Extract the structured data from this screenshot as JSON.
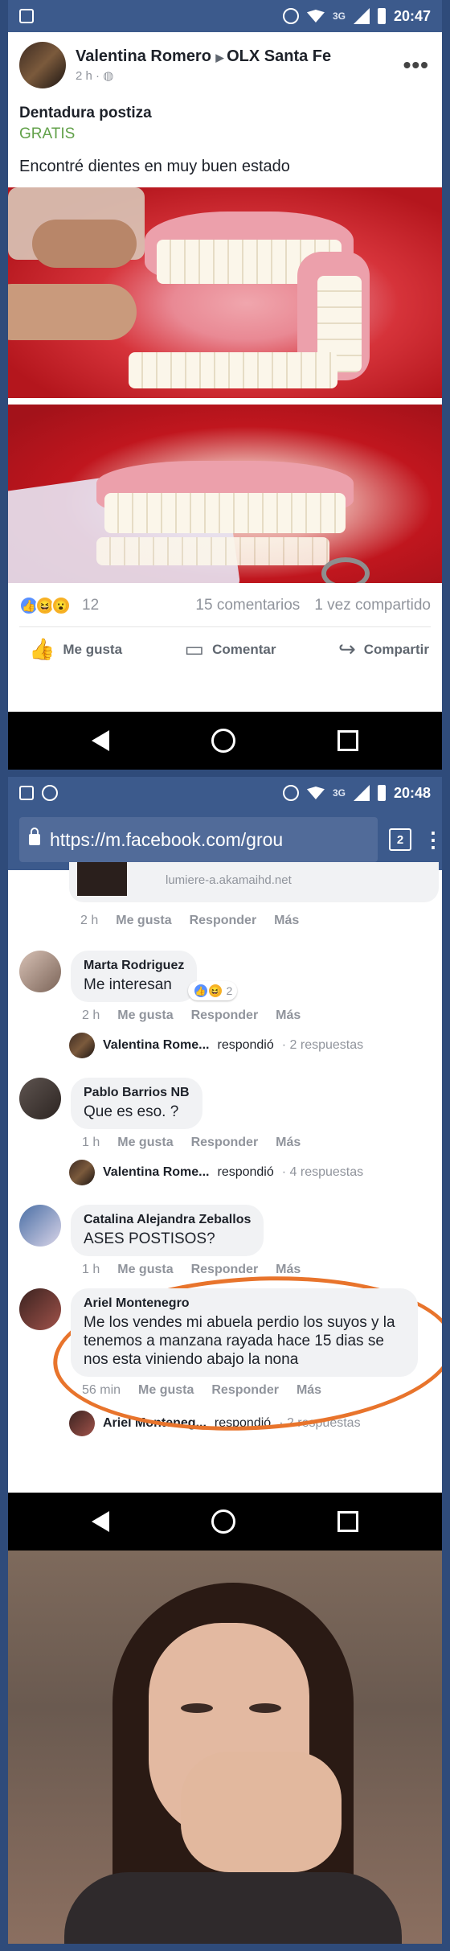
{
  "screen1": {
    "status": {
      "time": "20:47",
      "network": "3G"
    },
    "post": {
      "author": "Valentina Romero",
      "group": "OLX Santa Fe",
      "time": "2 h ·",
      "title": "Dentadura postiza",
      "price": "GRATIS",
      "description": "Encontré dientes en muy buen estado"
    },
    "stats": {
      "reaction_count": "12",
      "comments": "15 comentarios",
      "shares": "1 vez compartido"
    },
    "actions": {
      "like": "Me gusta",
      "comment": "Comentar",
      "share": "Compartir"
    }
  },
  "screen2": {
    "status": {
      "time": "20:48",
      "network": "3G"
    },
    "url": "https://m.facebook.com/grou",
    "tab_count": "2",
    "top_meta": {
      "time": "2 h",
      "like": "Me gusta",
      "reply": "Responder",
      "more": "Más"
    },
    "top_snippet": "lumiere-a.akamaihd.net",
    "comments": [
      {
        "name": "Marta Rodriguez",
        "text": "Me interesan",
        "time": "2 h",
        "like": "Me gusta",
        "reply": "Responder",
        "more": "Más",
        "reaction_count": "2",
        "reply_name": "Valentina Rome...",
        "reply_verb": "respondió",
        "reply_count": "· 2 respuestas"
      },
      {
        "name": "Pablo Barrios NB",
        "text": "Que es eso. ?",
        "time": "1 h",
        "like": "Me gusta",
        "reply": "Responder",
        "more": "Más",
        "reply_name": "Valentina Rome...",
        "reply_verb": "respondió",
        "reply_count": "· 4 respuestas"
      },
      {
        "name": "Catalina Alejandra Zeballos",
        "text": "ASES POSTISOS?",
        "time": "1 h",
        "like": "Me gusta",
        "reply": "Responder",
        "more": "Más"
      },
      {
        "name": "Ariel Montenegro",
        "text": "Me los vendes mi abuela perdio los suyos y la tenemos a manzana rayada hace 15 dias se nos esta viniendo abajo la nona",
        "time": "56 min",
        "like": "Me gusta",
        "reply": "Responder",
        "more": "Más",
        "reply_name": "Ariel Monteneg...",
        "reply_verb": "respondió",
        "reply_count": "· 2 respuestas"
      }
    ]
  },
  "colors": {
    "facebook_blue": "#3c5a8c",
    "price_green": "#62a14a",
    "highlight_orange": "#e8742c"
  }
}
